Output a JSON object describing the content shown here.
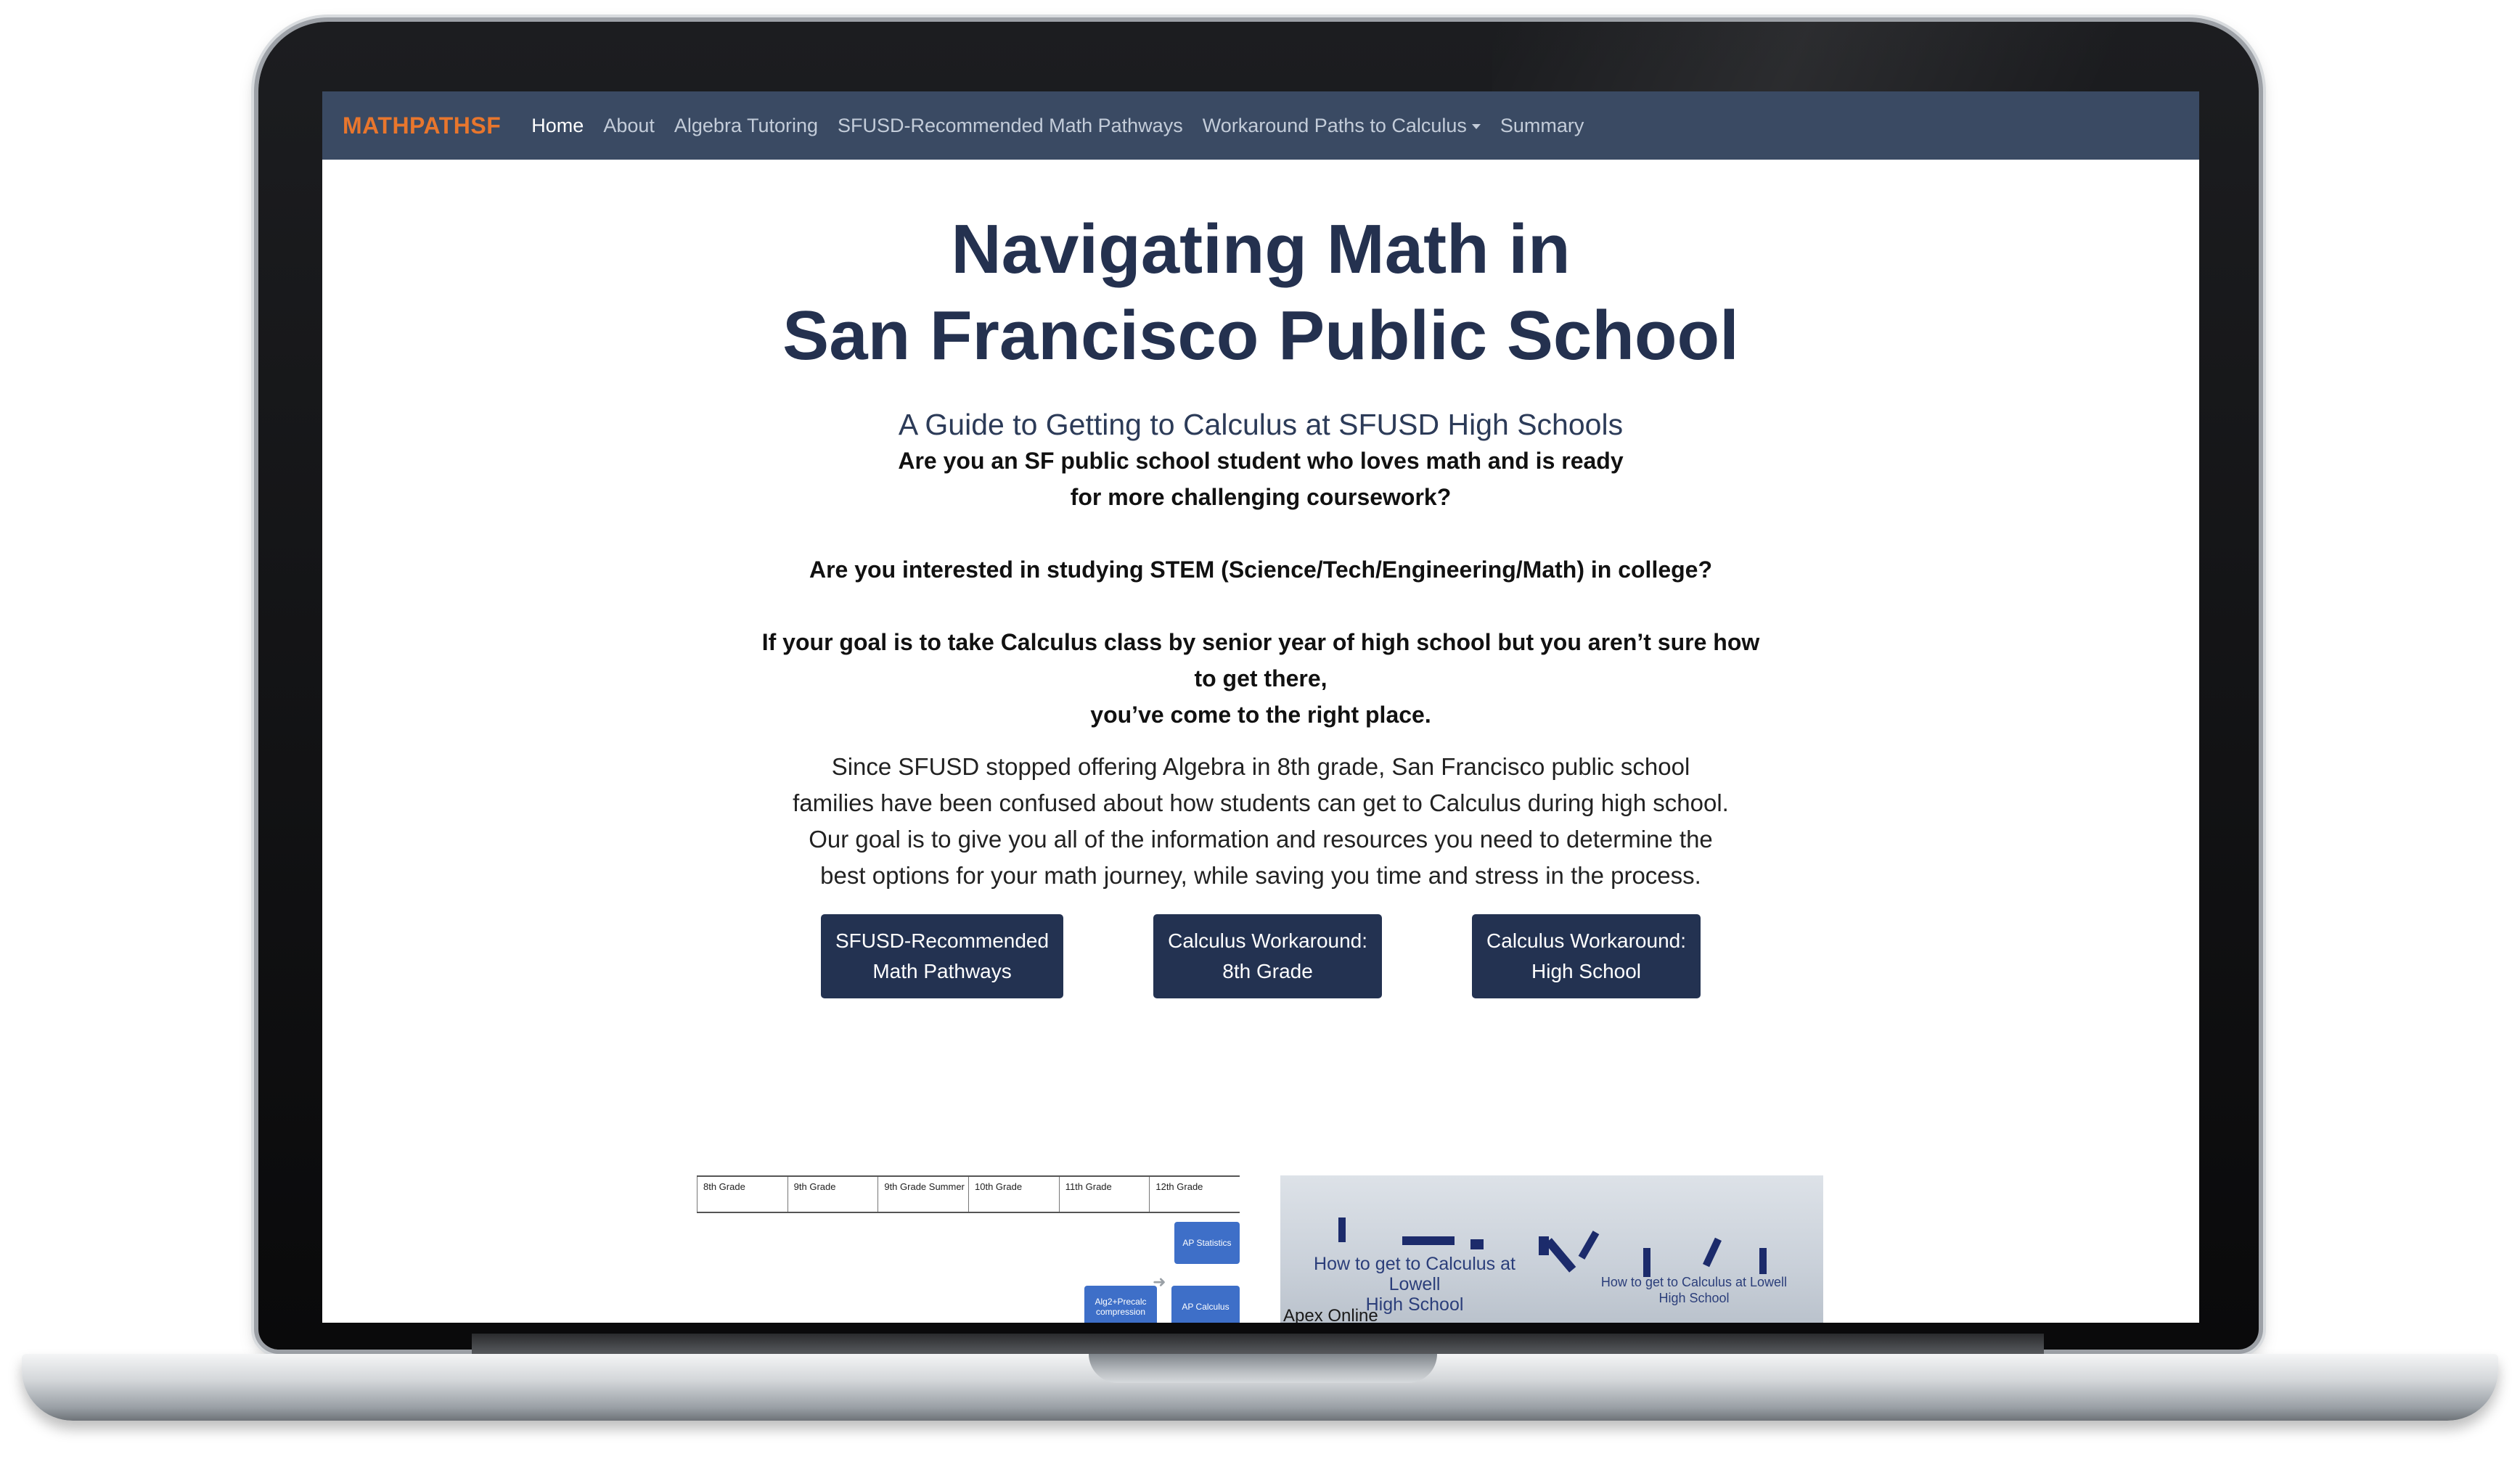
{
  "nav": {
    "brand": "MATHPATHSF",
    "items": [
      {
        "label": "Home"
      },
      {
        "label": "About"
      },
      {
        "label": "Algebra Tutoring"
      },
      {
        "label": "SFUSD-Recommended Math Pathways"
      },
      {
        "label": "Workaround Paths to Calculus"
      },
      {
        "label": "Summary"
      }
    ]
  },
  "hero": {
    "title_line1": "Navigating Math in",
    "title_line2": "San Francisco Public School",
    "subtitle": "A Guide to Getting to Calculus at SFUSD High Schools",
    "q1_line1": "Are you an SF public school student who loves math and is ready",
    "q1_line2": "for more challenging coursework?",
    "q2": "Are you interested in studying STEM (Science/Tech/Engineering/Math) in college?",
    "q3_line1": "If your goal is to take Calculus class by senior year of high school but you aren’t sure how",
    "q3_line2": "to get there,",
    "q3_line3": "you’ve come to the right place.",
    "paragraph": "Since SFUSD stopped offering Algebra in 8th grade, San Francisco public school families have been confused about how students can get to Calculus during high school. Our goal is to give you all of the information and resources you need to determine the best options for your math journey, while saving you time and stress in the process."
  },
  "buttons": [
    {
      "line1": "SFUSD-Recommended",
      "line2": "Math Pathways"
    },
    {
      "line1": "Calculus Workaround:",
      "line2": "8th Grade"
    },
    {
      "line1": "Calculus Workaround:",
      "line2": "High School"
    }
  ],
  "chart_image": {
    "columns": [
      "8th Grade",
      "9th Grade",
      "9th Grade Summer",
      "10th Grade",
      "11th Grade",
      "12th Grade"
    ],
    "boxes": [
      "AP Statistics",
      "Alg2+Precalc compression",
      "AP Calculus"
    ],
    "box_color": "#3e6fc8"
  },
  "board_image": {
    "text1_line1": "How to get to Calculus at Lowell",
    "text1_line2": "High School",
    "text2_line1": "How to get to Calculus at Lowell",
    "text2_line2": "High School",
    "text3": "Apex Online"
  },
  "colors": {
    "navbar": "#3a4a63",
    "brand": "#e8762d",
    "button": "#233251",
    "title": "#24314f"
  }
}
